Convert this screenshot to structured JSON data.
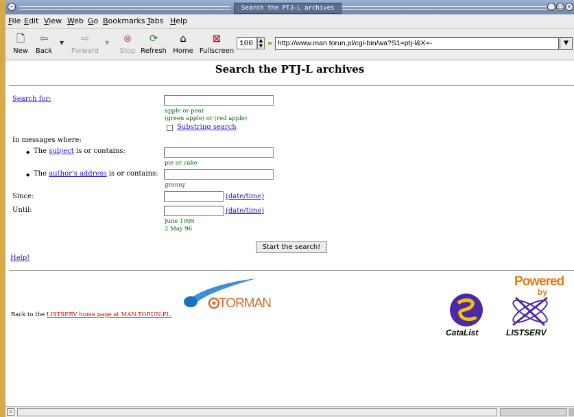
{
  "window": {
    "title": "Search the PTJ-L archives"
  },
  "menu": [
    "File",
    "Edit",
    "View",
    "Web",
    "Go",
    "Bookmarks",
    "Tabs",
    "Help"
  ],
  "toolbar": {
    "new": "New",
    "back": "Back",
    "forward": "Forward",
    "stop": "Stop",
    "refresh": "Refresh",
    "home": "Home",
    "fullscreen": "Fullscreen",
    "zoom": "100",
    "url": "http://www.man.torun.pl/cgi-bin/wa?S1=ptj-l&X=-"
  },
  "page": {
    "heading": "Search the PTJ-L archives",
    "search_for": "Search for:",
    "search_hint1": "apple or pear",
    "search_hint2": "(green apple) or (red apple)",
    "substring": "Substring search",
    "in_messages": "In messages where:",
    "the1": "The",
    "subject": "subject",
    "is_contains1": "is or contains:",
    "subject_hint": "pie or cake",
    "the2": "The",
    "author": "author's address",
    "is_contains2": "is or contains:",
    "author_hint": "granny",
    "since": "Since:",
    "until": "Until:",
    "datetime1": "(date/time)",
    "datetime2": "(date/time)",
    "date_hint1": "June 1995",
    "date_hint2": "2 May 96",
    "start_button": "Start the search!",
    "help": "Help!",
    "back_to": "Back to the",
    "listserv_link": "LISTSERV home page at MAN.TORUN.PL.",
    "torman_logo": "TORMAN",
    "powered": "Powered",
    "by": "by",
    "catalist": "CataList",
    "listserv_logo": "LISTSERV"
  }
}
